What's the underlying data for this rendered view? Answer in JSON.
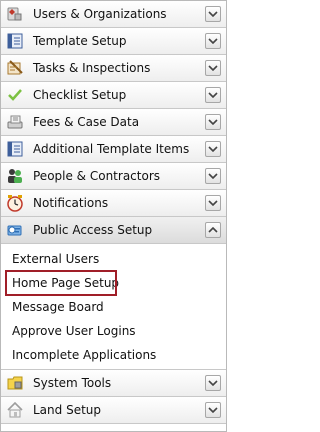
{
  "sections_top": [
    {
      "label": "Users & Organizations",
      "icon": "users-organizations-icon"
    },
    {
      "label": "Template Setup",
      "icon": "template-setup-icon"
    },
    {
      "label": "Tasks & Inspections",
      "icon": "tasks-inspections-icon"
    },
    {
      "label": "Checklist Setup",
      "icon": "checklist-checkmark-icon"
    },
    {
      "label": "Fees & Case Data",
      "icon": "fees-case-data-icon"
    },
    {
      "label": "Additional Template Items",
      "icon": "additional-template-items-icon"
    },
    {
      "label": "People & Contractors",
      "icon": "people-contractors-icon"
    },
    {
      "label": "Notifications",
      "icon": "notifications-clock-icon"
    }
  ],
  "active_section": {
    "label": "Public Access Setup",
    "icon": "public-access-icon"
  },
  "submenu": [
    {
      "label": "External Users"
    },
    {
      "label": "Home Page Setup",
      "selected": true
    },
    {
      "label": "Message Board"
    },
    {
      "label": "Approve User Logins"
    },
    {
      "label": "Incomplete Applications"
    }
  ],
  "sections_bottom": [
    {
      "label": "System Tools",
      "icon": "system-tools-icon"
    },
    {
      "label": "Land Setup",
      "icon": "land-setup-house-icon"
    }
  ],
  "colors": {
    "selected_outline": "#a01e28",
    "border": "#b9b9b9"
  }
}
